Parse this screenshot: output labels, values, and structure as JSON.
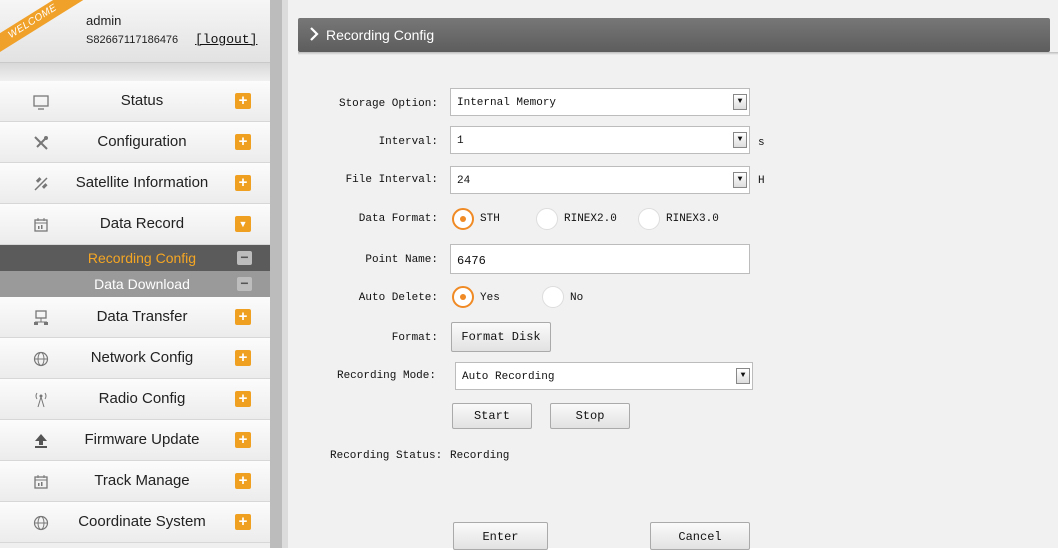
{
  "user": {
    "welcome": "WELCOME",
    "name": "admin",
    "serial": "S82667117186476",
    "logout": "[logout]"
  },
  "nav": {
    "status": "Status",
    "configuration": "Configuration",
    "satellite": "Satellite Information",
    "data_record": "Data Record",
    "recording_config": "Recording Config",
    "data_download": "Data Download",
    "data_transfer": "Data Transfer",
    "network_config": "Network Config",
    "radio_config": "Radio Config",
    "firmware_update": "Firmware Update",
    "track_manage": "Track Manage",
    "coordinate_system": "Coordinate System"
  },
  "icons": {
    "plus": "+",
    "down": "▼",
    "minus": "−",
    "status": "monitor-icon",
    "configuration": "tools-icon",
    "satellite": "satellite-icon",
    "data_record": "calendar-icon",
    "data_transfer": "network-transfer-icon",
    "network": "globe-icon",
    "radio": "antenna-icon",
    "firmware": "upload-icon",
    "track": "calendar-icon",
    "coordinate": "globe-icon"
  },
  "colors": {
    "accent": "#f0a020",
    "active_sub_text": "#f5a623",
    "radio_selected": "#f08a24"
  },
  "main": {
    "title": "Recording Config"
  },
  "form": {
    "storage_option": {
      "label": "Storage Option:",
      "value": "Internal Memory"
    },
    "interval": {
      "label": "Interval:",
      "value": "1",
      "unit": "s"
    },
    "file_interval": {
      "label": "File Interval:",
      "value": "24",
      "unit": "H"
    },
    "data_format": {
      "label": "Data Format:",
      "options": [
        "STH",
        "RINEX2.0",
        "RINEX3.0"
      ],
      "selected": "STH"
    },
    "point_name": {
      "label": "Point Name:",
      "value": "6476"
    },
    "auto_delete": {
      "label": "Auto Delete:",
      "options": [
        "Yes",
        "No"
      ],
      "selected": "Yes"
    },
    "format": {
      "label": "Format:",
      "button": "Format Disk"
    },
    "recording_mode": {
      "label": "Recording Mode:",
      "value": "Auto Recording"
    },
    "start": "Start",
    "stop": "Stop",
    "recording_status": {
      "label": "Recording Status:",
      "value": "Recording"
    },
    "enter": "Enter",
    "cancel": "Cancel"
  }
}
